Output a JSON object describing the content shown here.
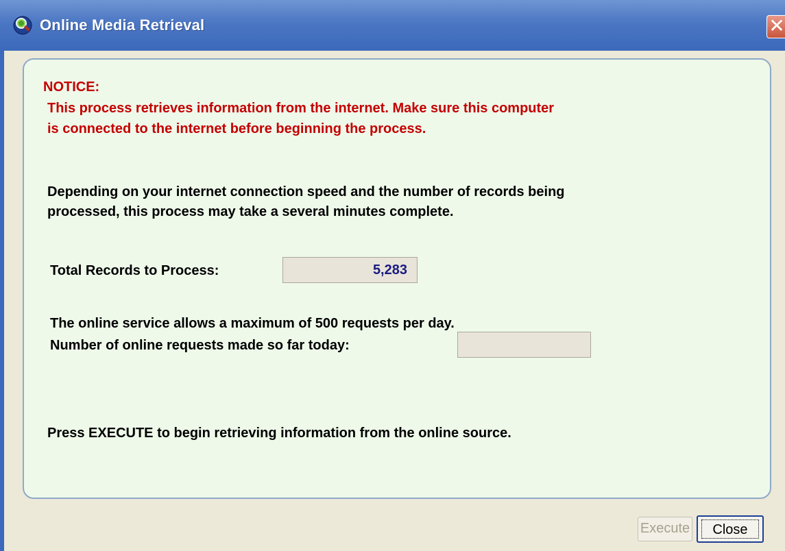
{
  "window": {
    "title": "Online Media Retrieval",
    "icon": "app-magnifier-icon",
    "close_icon": "close-icon"
  },
  "notice": {
    "heading": "NOTICE:",
    "line1": "This process retrieves information from the internet.  Make sure this computer",
    "line2": "is connected to the internet before beginning the process."
  },
  "info": {
    "line1": "Depending on your internet connection speed and the number of records being",
    "line2": "processed, this process may take a several minutes complete."
  },
  "records": {
    "label": "Total Records to Process:",
    "value": "5,283"
  },
  "requests": {
    "limit_text": "The online service allows a maximum of 500 requests per day.",
    "label": "Number of online requests made so far today:",
    "value": ""
  },
  "instruction": "Press EXECUTE to begin retrieving information from the online source.",
  "buttons": {
    "execute": "Execute",
    "close": "Close"
  },
  "colors": {
    "notice": "#c40000",
    "panel_bg": "#eef9ea",
    "titlebar": "#4b76c3"
  }
}
